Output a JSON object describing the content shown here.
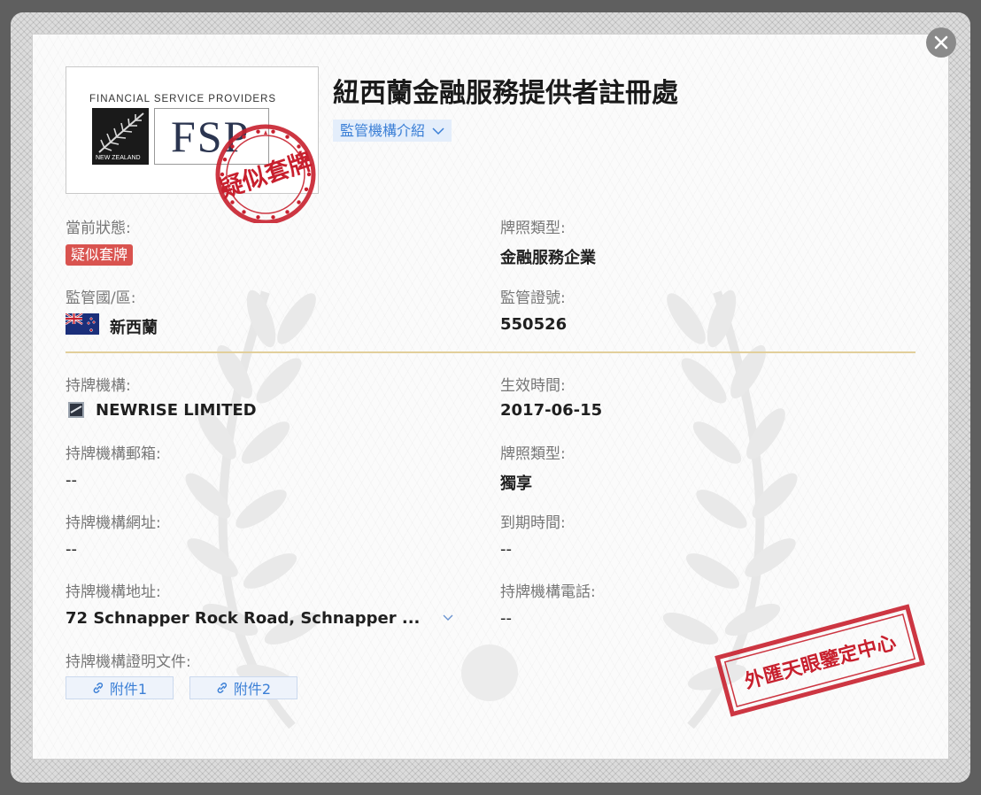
{
  "dialog": {
    "title": "紐西蘭金融服務提供者註冊處",
    "regulator_intro_label": "監管機構介紹",
    "close_icon": "close-icon"
  },
  "logo": {
    "top_text": "FINANCIAL SERVICE PROVIDERS",
    "country_text": "NEW ZEALAND",
    "acronym": "FSP"
  },
  "round_stamp": {
    "text": "疑似套牌",
    "color": "#c8202e"
  },
  "fields": {
    "current_status_label": "當前狀態:",
    "current_status_value": "疑似套牌",
    "license_type_label": "牌照類型:",
    "license_type_value": "金融服務企業",
    "region_label": "監管國/區:",
    "region_value": "新西蘭",
    "license_no_label": "監管證號:",
    "license_no_value": "550526",
    "holder_label": "持牌機構:",
    "holder_value": "NEWRISE LIMITED",
    "effective_label": "生效時間:",
    "effective_value": "2017-06-15",
    "email_label": "持牌機構郵箱:",
    "email_value": "--",
    "license_type2_label": "牌照類型:",
    "license_type2_value": "獨享",
    "website_label": "持牌機構網址:",
    "website_value": "--",
    "expiry_label": "到期時間:",
    "expiry_value": "--",
    "address_label": "持牌機構地址:",
    "address_value": "72 Schnapper Rock Road, Schnapper ...",
    "phone_label": "持牌機構電話:",
    "phone_value": "--",
    "documents_label": "持牌機構證明文件:"
  },
  "attachments": [
    "附件1",
    "附件2"
  ],
  "rect_stamp": {
    "text": "外匯天眼鑒定中心",
    "color": "#c8202e"
  },
  "colors": {
    "status_badge": "#d9534f",
    "link_blue": "#3b7fd6",
    "divider_gold": "#e2cf9b"
  }
}
